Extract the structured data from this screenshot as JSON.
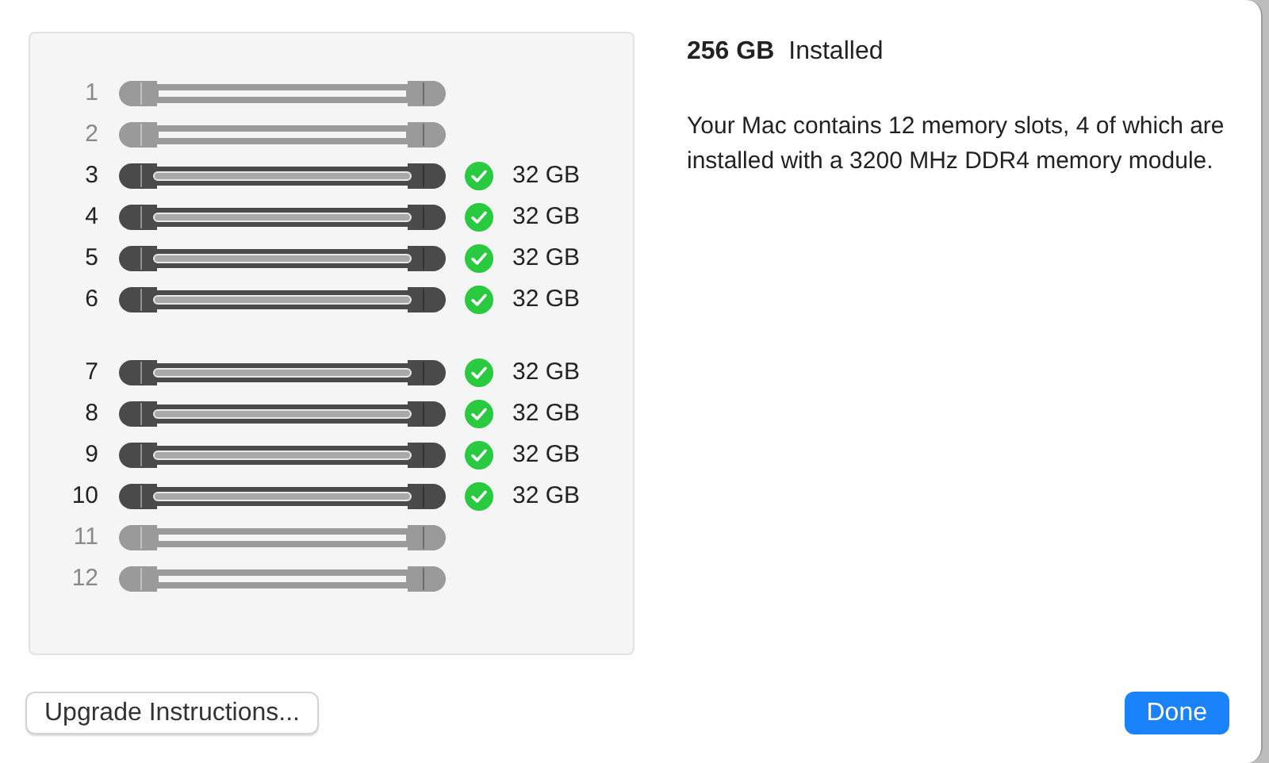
{
  "slot_groups": [
    {
      "slots": [
        {
          "number": "1",
          "installed": false
        },
        {
          "number": "2",
          "installed": false
        },
        {
          "number": "3",
          "installed": true,
          "size": "32 GB"
        },
        {
          "number": "4",
          "installed": true,
          "size": "32 GB"
        },
        {
          "number": "5",
          "installed": true,
          "size": "32 GB"
        },
        {
          "number": "6",
          "installed": true,
          "size": "32 GB"
        }
      ]
    },
    {
      "slots": [
        {
          "number": "7",
          "installed": true,
          "size": "32 GB"
        },
        {
          "number": "8",
          "installed": true,
          "size": "32 GB"
        },
        {
          "number": "9",
          "installed": true,
          "size": "32 GB"
        },
        {
          "number": "10",
          "installed": true,
          "size": "32 GB"
        },
        {
          "number": "11",
          "installed": false
        },
        {
          "number": "12",
          "installed": false
        }
      ]
    }
  ],
  "summary": {
    "total": "256 GB",
    "label": "Installed",
    "description": "Your Mac contains 12 memory slots, 4 of which are installed with a 3200 MHz DDR4 memory module."
  },
  "buttons": [
    {
      "label": "Upgrade Instructions...",
      "kind": "secondary"
    },
    {
      "label": "Done",
      "kind": "primary"
    }
  ]
}
